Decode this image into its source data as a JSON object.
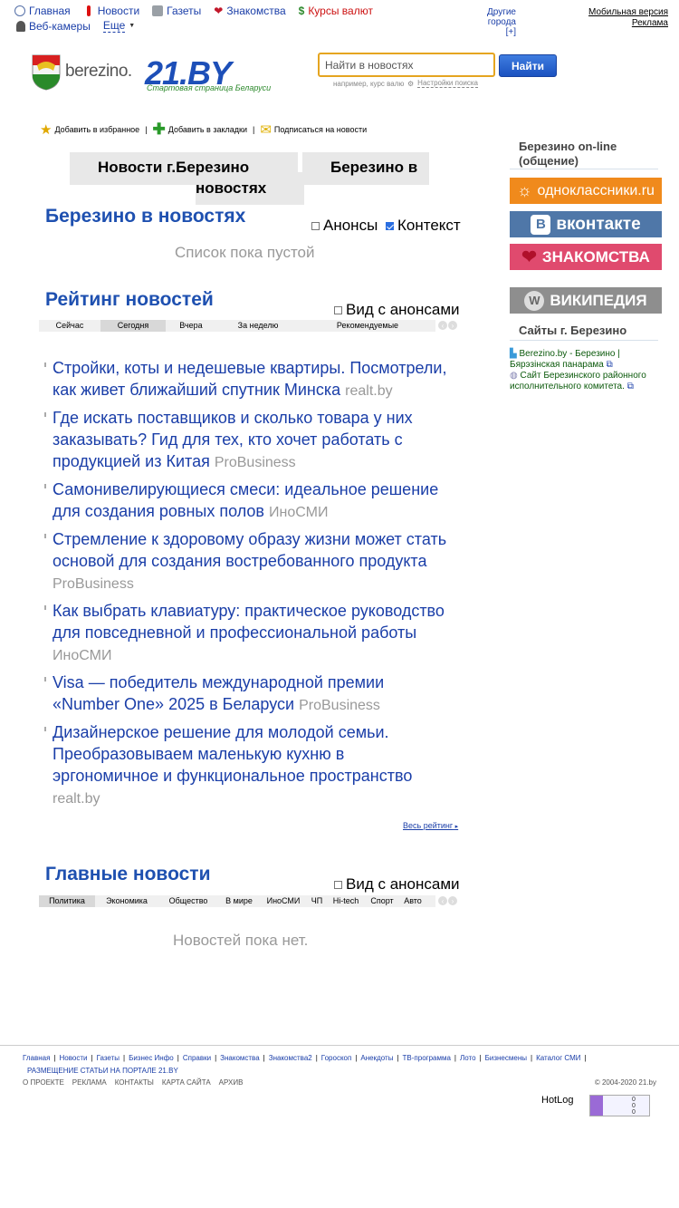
{
  "topnav": {
    "row1": [
      {
        "label": "Главная",
        "icon": "globe-icon",
        "color": "#1a3ea8"
      },
      {
        "label": "Новости",
        "icon": "exclamation-icon",
        "color": "#1a3ea8"
      },
      {
        "label": "Газеты",
        "icon": "newspaper-icon",
        "color": "#1a3ea8"
      },
      {
        "label": "Знакомства",
        "icon": "heart-icon",
        "color": "#1a3ea8"
      },
      {
        "label": "Курсы валют",
        "icon": "dollar-icon",
        "color": "#cc1111"
      }
    ],
    "row2": [
      {
        "label": "Веб-камеры",
        "icon": "webcam-icon"
      },
      {
        "label": "Еще"
      }
    ]
  },
  "cities": {
    "label": "Другие города",
    "toggle": "[+]"
  },
  "topright": {
    "mobile": "Мобильная версия",
    "ads": "Реклама"
  },
  "logo": {
    "city": "berezino.",
    "brand": "21.BY",
    "slogan": "Стартовая страница Беларуси"
  },
  "search": {
    "placeholder": "Найти в новостях",
    "button": "Найти",
    "hint": "например, курс валю",
    "settings": "Настройки поиска"
  },
  "actions": [
    {
      "label": "Добавить в избранное",
      "icon": "star-icon"
    },
    {
      "label": "Добавить в закладки",
      "icon": "plus-icon"
    },
    {
      "label": "Подписаться на новости",
      "icon": "envelope-icon"
    }
  ],
  "tabs": {
    "tab1": "Новости г.Березино",
    "tab2": "новостях",
    "tab3": "Березино в"
  },
  "section_news": {
    "title": "Березино в новостях",
    "opt1": "Анонсы",
    "opt2": "Контекст",
    "empty": "Список пока пустой"
  },
  "section_rating": {
    "title": "Рейтинг новостей",
    "opt": "Вид с анонсами",
    "filters": [
      "Сейчас",
      "Сегодня",
      "Вчера",
      "За неделю",
      "Рекомендуемые"
    ],
    "active": "Сегодня",
    "items": [
      {
        "title": "Стройки, коты и недешевые квартиры. Посмотрели, как живет ближайший спутник Минска",
        "source": "realt.by"
      },
      {
        "title": "Где искать поставщиков и сколько товара у них заказывать? Гид для тех, кто хочет работать с продукцией из Китая",
        "source": "ProBusiness"
      },
      {
        "title": "Самонивелирующиеся смеси: идеальное решение для создания ровных полов",
        "source": "ИноСМИ"
      },
      {
        "title": "Стремление к здоровому образу жизни может стать основой для создания востребованного продукта",
        "source": "ProBusiness"
      },
      {
        "title": "Как выбрать клавиатуру: практическое руководство для повседневной и профессиональной работы",
        "source": "ИноСМИ"
      },
      {
        "title": "Visa — победитель международной премии «Number One» 2025 в Беларуси",
        "source": "ProBusiness"
      },
      {
        "title": "Дизайнерское решение для молодой семьи. Преобразовываем маленькую кухню в эргономичное и функциональное пространство",
        "source": "realt.by"
      }
    ],
    "all": "Весь рейтинг"
  },
  "section_main": {
    "title": "Главные новости",
    "opt": "Вид с анонсами",
    "filters": [
      "Политика",
      "Экономика",
      "Общество",
      "В мире",
      "ИноСМИ",
      "ЧП",
      "Hi-tech",
      "Спорт",
      "Авто"
    ],
    "active": "Политика",
    "empty": "Новостей пока нет."
  },
  "right": {
    "online_title": "Березино on-line (общение)",
    "banners": [
      "одноклассники.ru",
      "вконтакте",
      "ЗНАКОМСТВА",
      "ВИКИПЕДИЯ"
    ],
    "sites_title": "Сайты г. Березино",
    "sites": [
      "Berezino.by - Березино | Бярэзінская панарама",
      "Сайт Березинского районного исполнительного комитета."
    ]
  },
  "footer": {
    "links": [
      "Главная",
      "Новости",
      "Газеты",
      "Бизнес Инфо",
      "Справки",
      "Знакомства",
      "Знакомства2",
      "Гороскоп",
      "Анекдоты",
      "ТВ-программа",
      "Лото",
      "Бизнесмены",
      "Каталог СМИ"
    ],
    "placement": "РАЗМЕЩЕНИЕ СТАТЬИ НА ПОРТАЛЕ 21.BY",
    "bottom": [
      "О ПРОЕКТЕ",
      "РЕКЛАМА",
      "КОНТАКТЫ",
      "КАРТА САЙТА",
      "АРХИВ"
    ],
    "copyright": "© 2004-2020 21.by",
    "hotlog": "HotLog",
    "counter": [
      "0",
      "0",
      "0"
    ]
  },
  "colors": {
    "brand": "#1d4fb8",
    "link": "#1a3ea8",
    "search_border": "#e5a520"
  }
}
